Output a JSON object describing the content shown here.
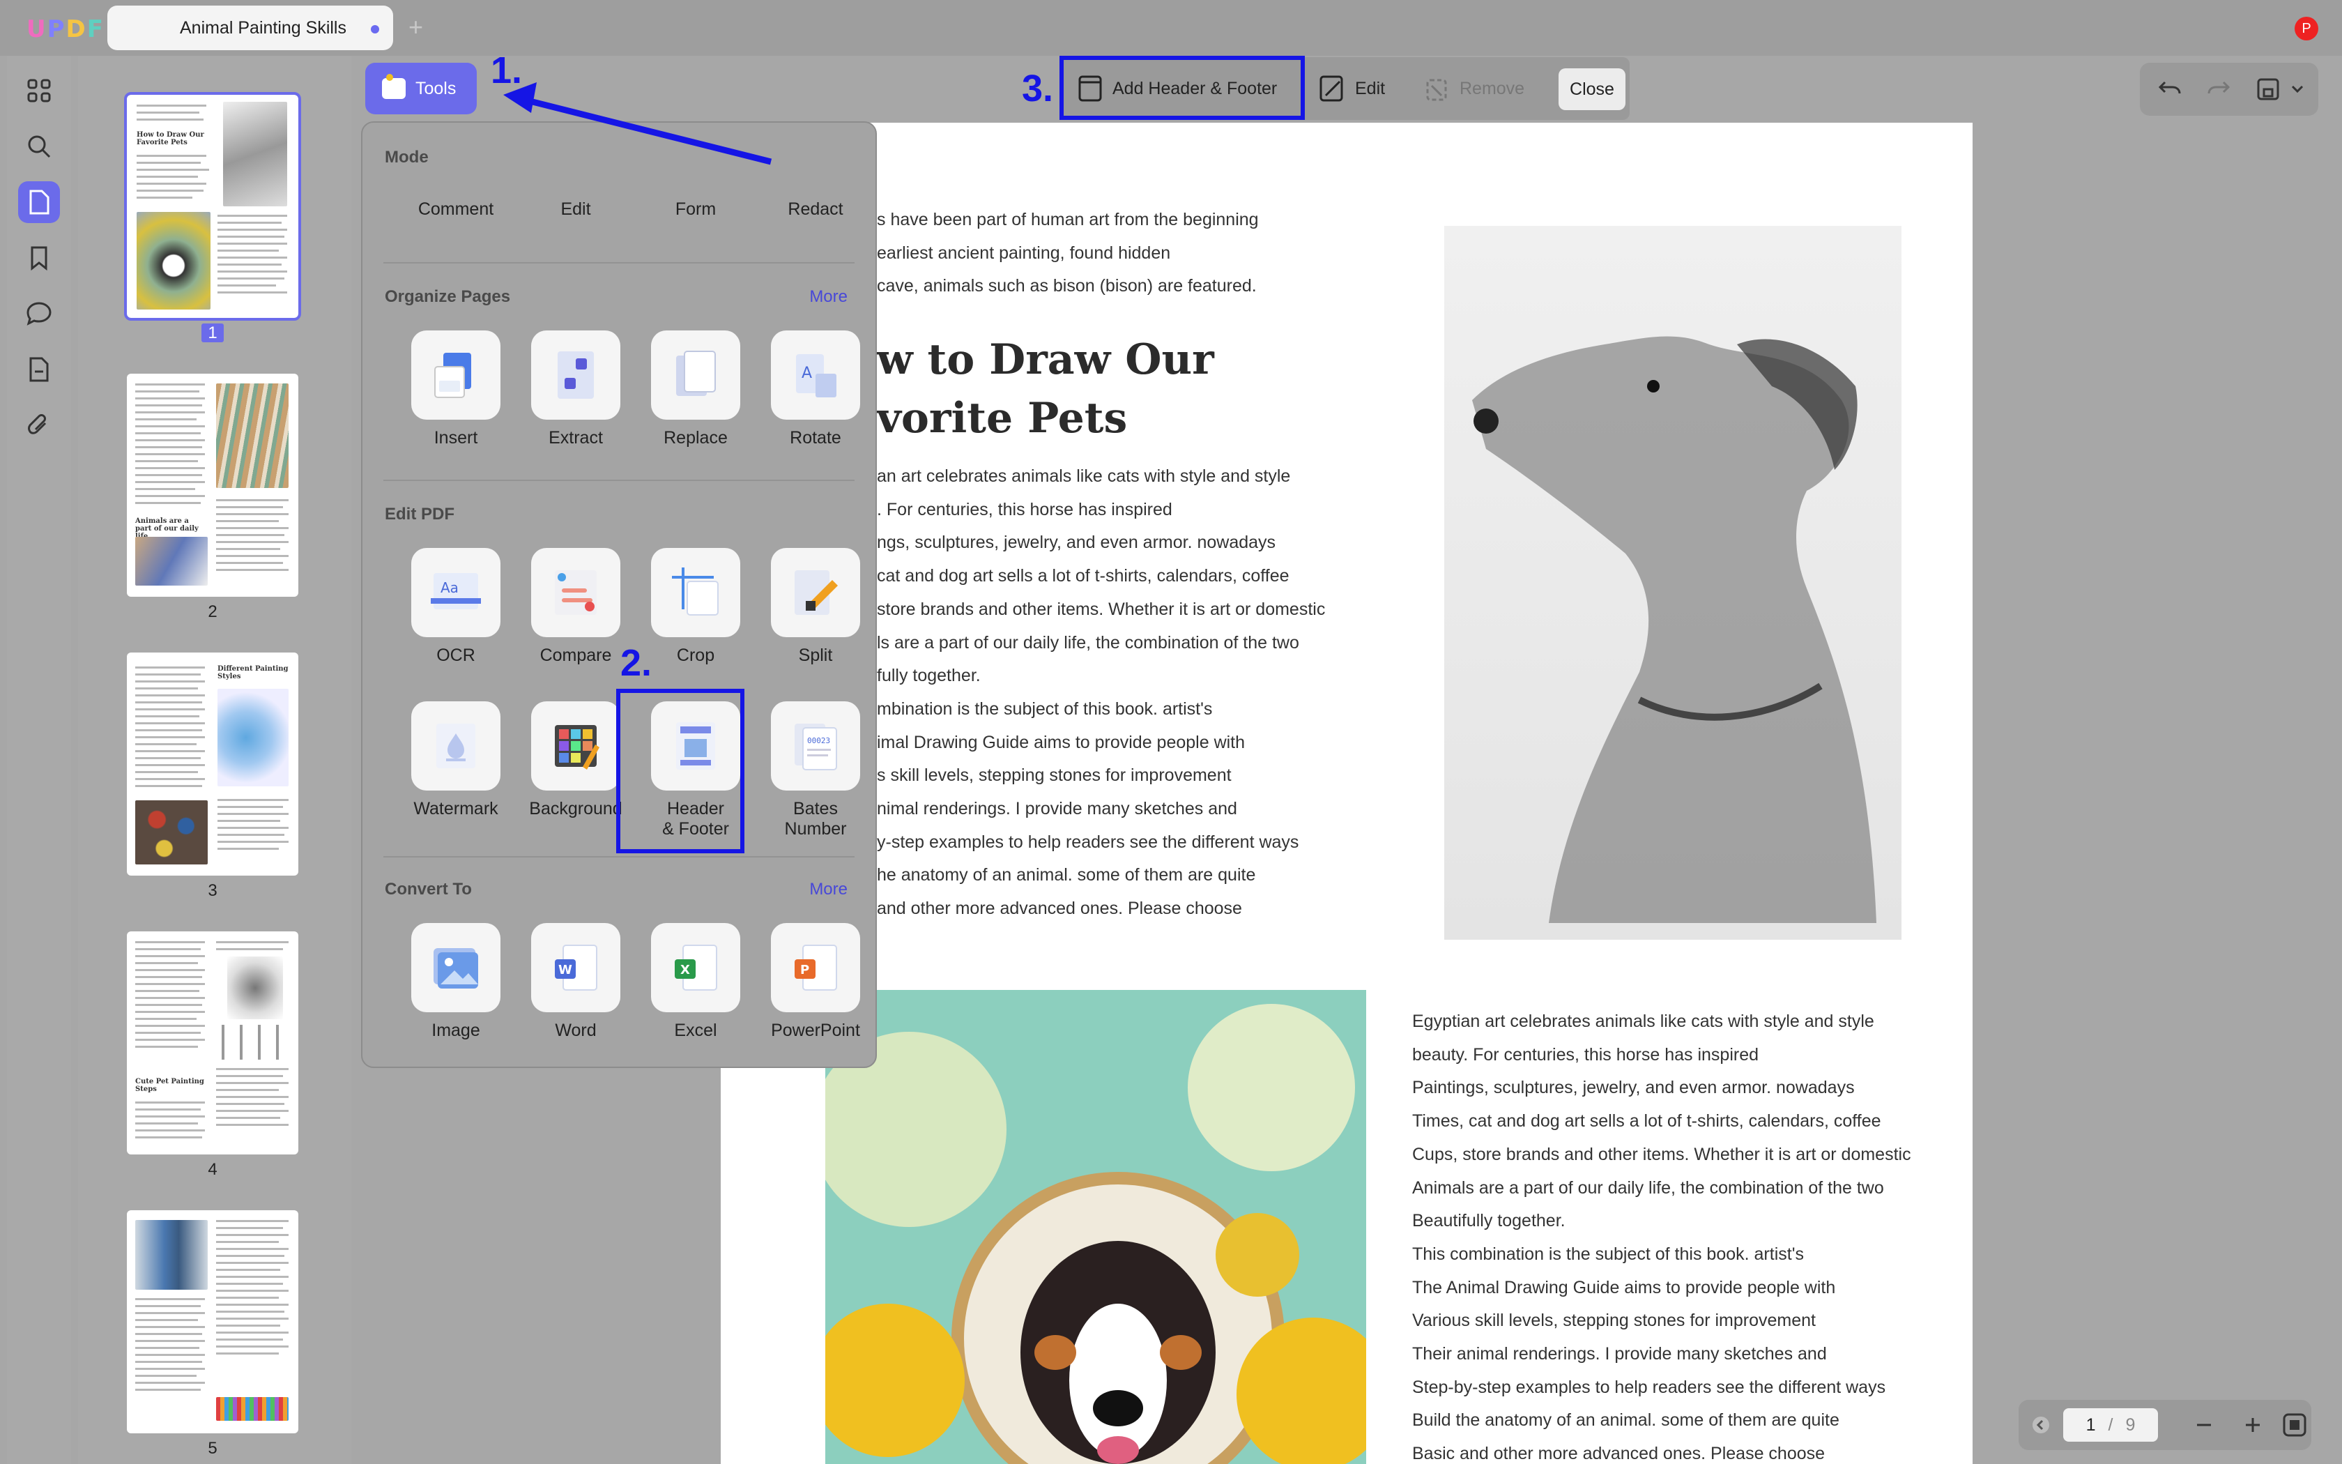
{
  "app": {
    "logo": "UPDF",
    "tab_title": "Animal Painting Skills",
    "new_tab": "+",
    "avatar": "P"
  },
  "toolbar": {
    "tools_label": "Tools",
    "add_hf_label": "Add Header & Footer",
    "edit_label": "Edit",
    "remove_label": "Remove",
    "close_label": "Close"
  },
  "annotations": {
    "step1": "1.",
    "step2": "2.",
    "step3": "3."
  },
  "panel": {
    "mode_title": "Mode",
    "modes": [
      "Comment",
      "Edit",
      "Form",
      "Redact"
    ],
    "organize_title": "Organize Pages",
    "organize_more": "More",
    "organize": [
      "Insert",
      "Extract",
      "Replace",
      "Rotate"
    ],
    "edit_title": "Edit PDF",
    "edit_row1": [
      "OCR",
      "Compare",
      "Crop",
      "Split"
    ],
    "edit_row2": [
      "Watermark",
      "Background",
      "Header\n& Footer",
      "Bates\nNumber"
    ],
    "convert_title": "Convert To",
    "convert_more": "More",
    "convert": [
      "Image",
      "Word",
      "Excel",
      "PowerPoint"
    ]
  },
  "thumbnails": {
    "numbers": [
      "1",
      "2",
      "3",
      "4",
      "5"
    ],
    "head1": "How to Draw Our Favorite Pets",
    "head2": "Animals are a part of our daily life",
    "head3": "Different Painting Styles",
    "head4": "Cute Pet Painting Steps"
  },
  "document": {
    "intro": [
      "s have been part of human art from the beginning",
      "earliest ancient painting, found hidden",
      "cave, animals such as bison (bison) are featured."
    ],
    "heading": [
      "w to Draw Our",
      "vorite Pets"
    ],
    "col1": [
      "an art celebrates animals like cats with style and style",
      ". For centuries, this horse has inspired",
      "ngs, sculptures, jewelry, and even armor. nowadays",
      "cat and dog art sells a lot of t-shirts, calendars, coffee",
      "store brands and other items. Whether it is art or domestic",
      "ls are a part of our daily life, the combination of the two",
      "fully together.",
      "mbination is the subject of this book. artist's",
      "imal Drawing Guide aims to provide people with",
      "s skill levels, stepping stones for improvement",
      "nimal renderings. I provide many sketches and",
      "y-step examples to help readers see the different ways",
      "he anatomy of an animal. some of them are quite",
      "and other more advanced ones. Please choose"
    ],
    "col2": [
      "Egyptian art celebrates animals like cats with style and style",
      "beauty. For centuries, this horse has inspired",
      "Paintings, sculptures, jewelry, and even armor. nowadays",
      "Times, cat and dog art sells a lot of t-shirts, calendars, coffee",
      "Cups, store brands and other items. Whether it is art or domestic",
      "Animals are a part of our daily life, the combination of the two",
      "Beautifully together.",
      "This combination is the subject of this book. artist's",
      "The Animal Drawing Guide aims to provide people with",
      "Various skill levels, stepping stones for improvement",
      "Their animal renderings. I provide many sketches and",
      "Step-by-step examples to help readers see the different ways",
      "Build the anatomy of an animal. some of them are quite",
      "Basic and other more advanced ones. Please choose"
    ]
  },
  "pagination": {
    "current": "1",
    "separator": "/",
    "total": "9"
  }
}
